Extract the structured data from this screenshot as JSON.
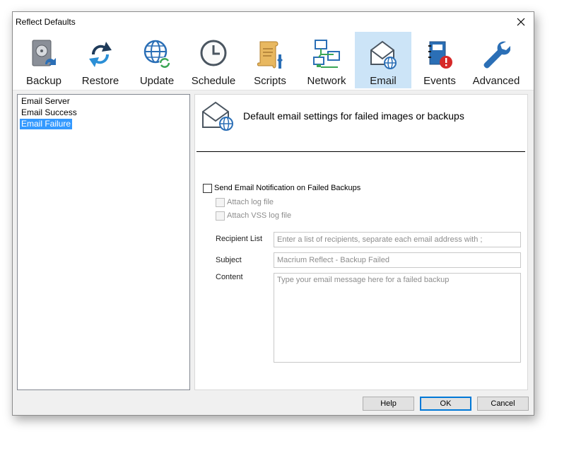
{
  "window": {
    "title": "Reflect Defaults"
  },
  "toolbar": {
    "items": [
      {
        "label": "Backup",
        "icon": "backup-icon"
      },
      {
        "label": "Restore",
        "icon": "restore-icon"
      },
      {
        "label": "Update",
        "icon": "update-icon"
      },
      {
        "label": "Schedule",
        "icon": "schedule-icon"
      },
      {
        "label": "Scripts",
        "icon": "scripts-icon"
      },
      {
        "label": "Network",
        "icon": "network-icon"
      },
      {
        "label": "Email",
        "icon": "email-icon",
        "selected": true
      },
      {
        "label": "Events",
        "icon": "events-icon"
      },
      {
        "label": "Advanced",
        "icon": "advanced-icon"
      }
    ]
  },
  "tree": {
    "items": [
      {
        "label": "Email Server"
      },
      {
        "label": "Email Success"
      },
      {
        "label": "Email Failure",
        "selected": true
      }
    ]
  },
  "panel": {
    "header": "Default email settings for failed images or backups",
    "send_notification": {
      "label": "Send Email Notification on Failed Backups",
      "checked": false
    },
    "attach_log": {
      "label": "Attach log file",
      "checked": false,
      "disabled": true
    },
    "attach_vss_log": {
      "label": "Attach VSS log file",
      "checked": false,
      "disabled": true
    },
    "recipient": {
      "label": "Recipient List",
      "value": "",
      "placeholder": "Enter a list of recipients, separate each email address with ;"
    },
    "subject": {
      "label": "Subject",
      "value": "",
      "placeholder": "Macrium Reflect - Backup Failed"
    },
    "content": {
      "label": "Content",
      "value": "",
      "placeholder": "Type your email message here for a failed backup"
    }
  },
  "buttons": {
    "help": "Help",
    "ok": "OK",
    "cancel": "Cancel"
  },
  "colors": {
    "selection": "#3399ff",
    "toolbar_selected": "#cce4f7",
    "accent": "#0078d7"
  }
}
